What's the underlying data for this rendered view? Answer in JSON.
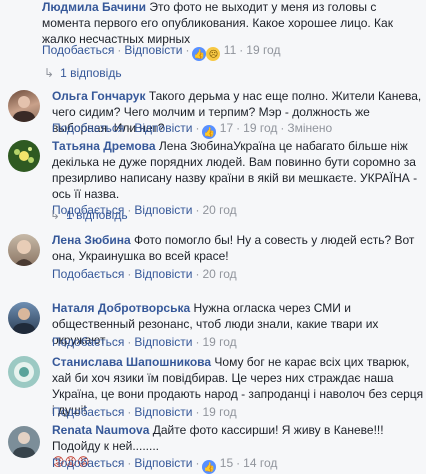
{
  "actions": {
    "like": "Подобається",
    "reply": "Відповісти"
  },
  "comments": [
    {
      "author": "Людмила Бачини",
      "text": "Это фото не выходит у меня из головы с момента первого его опубликования. Какое хорошее лицо. Как жалко несчастных мирных",
      "reactions_count": "11",
      "time": "19 год"
    },
    {
      "author": "Ольга Гончарук",
      "text": "Такого дерьма у нас еще полно. Жители Канева, чего сидим? Чего молчим и терпим? Мэр - должность же выборная. Или нет?",
      "reactions_count": "17",
      "time": "19 год",
      "edited": "Змінено"
    },
    {
      "author": "Татьяна Дремова",
      "text": "Лена ЗюбинаУкраїна це набагато більше ніж декілька не дуже порядних людей. Вам повинно бути соромно за презирливо написану назву країни в якій ви мешкаєте. УКРАЇНА - ось її назва.",
      "reactions_count": "",
      "time": "20 год"
    },
    {
      "author": "Лена Зюбина",
      "text": "Фото помогло бы! Ну а совесть у людей есть? Вот она, Украинушка во всей красе!",
      "reactions_count": "",
      "time": "20 год"
    },
    {
      "author": "Наталя Добротворська",
      "text": "Нужна огласка через СМИ и общественный резонанс, чтоб люди знали, какие твари их окружают",
      "reactions_count": "",
      "time": "19 год"
    },
    {
      "author": "Станислава Шапошникова",
      "text": "Чому бог не карає всіх цих тварюк, хай би хоч язики їм повідбирав. Це через них страждає наша Україна, це вони продають народ - запроданці і наволоч без серця і душі!",
      "reactions_count": "",
      "time": "19 год"
    },
    {
      "author": "Renata Naumova",
      "text": "Дайте фото кассирши! Я живу в Каневе!!! Подойду к ней........",
      "emoji_line": "😡😡😡",
      "reactions_count": "15",
      "time": "14 год"
    }
  ],
  "replies": [
    {
      "label": "1 відповідь"
    },
    {
      "label": "1 відповідь"
    }
  ],
  "icons": {
    "reply_arrow": "↳"
  }
}
